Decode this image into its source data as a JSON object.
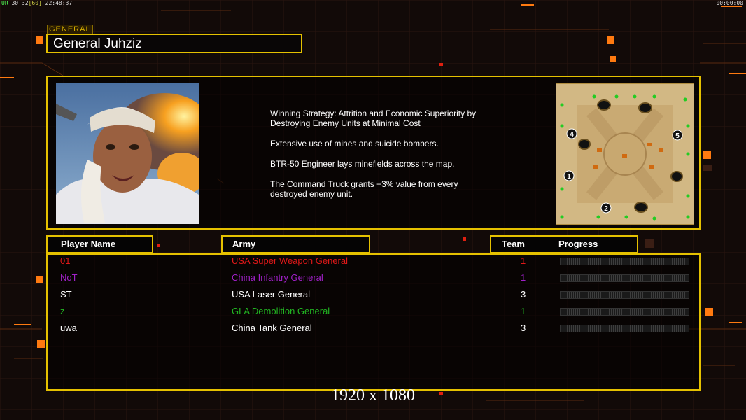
{
  "hud": {
    "top_left_prefix": "UR",
    "top_left_fps": "30 32",
    "top_left_limit": "[60]",
    "top_left_time": "22:48:37",
    "top_right_timer": "00:00:00"
  },
  "general": {
    "tag": "GENERAL",
    "name": "General Juhziz",
    "description": [
      "Winning Strategy: Attrition and Economic Superiority by\n Destroying Enemy Units at Minimal Cost",
      "Extensive use of mines and suicide bombers.",
      "BTR-50 Engineer lays minefields across the map.",
      "The Command Truck grants +3% value from every\n destroyed enemy unit."
    ]
  },
  "map": {
    "start_positions": [
      "1",
      "2",
      "4",
      "5"
    ]
  },
  "headers": {
    "player_name": "Player Name",
    "army": "Army",
    "team": "Team",
    "progress": "Progress"
  },
  "players": [
    {
      "name": "01",
      "army": "USA Super Weapon General",
      "team": "1",
      "color": "#e01818"
    },
    {
      "name": "NoT",
      "army": "China Infantry General",
      "team": "1",
      "color": "#a020c8"
    },
    {
      "name": "ST",
      "army": "USA Laser General",
      "team": "3",
      "color": "#ffffff"
    },
    {
      "name": "z",
      "army": "GLA Demolition General",
      "team": "1",
      "color": "#22b422"
    },
    {
      "name": "uwa",
      "army": "China Tank General",
      "team": "3",
      "color": "#ffffff"
    }
  ],
  "resolution_label": "1920 x 1080",
  "colors": {
    "frame": "#e5c100",
    "background": "#120a08",
    "accent_orange": "#ff7a10"
  }
}
